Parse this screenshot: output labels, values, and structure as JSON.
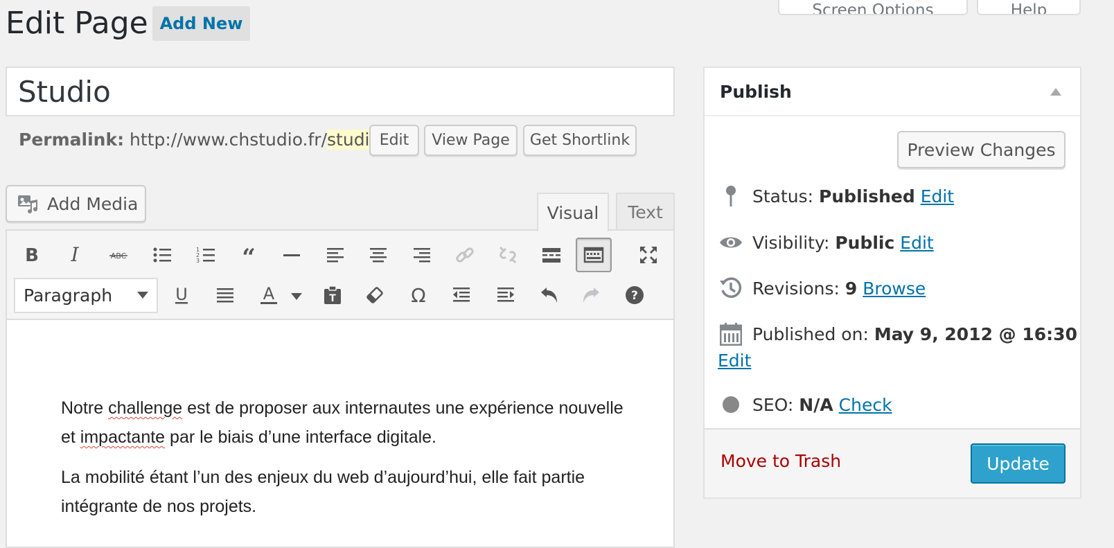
{
  "header": {
    "title": "Edit Page",
    "add_new": "Add New",
    "screen_options": "Screen Options",
    "help": "Help"
  },
  "post": {
    "title": "Studio",
    "permalink_label": "Permalink:",
    "permalink_base": "http://www.chstudio.fr/",
    "permalink_slug": "studio",
    "permalink_trail": "/",
    "edit_btn": "Edit",
    "view_page_btn": "View Page",
    "shortlink_btn": "Get Shortlink"
  },
  "editor": {
    "add_media": "Add Media",
    "tab_visual": "Visual",
    "tab_text": "Text",
    "format_select": "Paragraph",
    "p1_a": "Notre ",
    "p1_spell1": "challenge",
    "p1_b": " est de proposer aux internautes une expérience nouvelle et ",
    "p1_spell2": "impactante",
    "p1_c": " par le biais d’une interface digitale.",
    "p2": "La mobilité étant l’un des enjeux du web d’aujourd’hui, elle fait partie intégrante de nos projets."
  },
  "publish": {
    "title": "Publish",
    "preview_changes": "Preview Changes",
    "status_label": "Status:",
    "status_value": "Published",
    "status_edit": "Edit",
    "visibility_label": "Visibility:",
    "visibility_value": "Public",
    "visibility_edit": "Edit",
    "revisions_label": "Revisions:",
    "revisions_value": "9",
    "revisions_browse": "Browse",
    "published_label": "Published on:",
    "published_value": "May 9, 2012 @ 16:30",
    "published_edit": "Edit",
    "seo_label": "SEO:",
    "seo_value": "N/A",
    "seo_check": "Check",
    "move_to_trash": "Move to Trash",
    "update": "Update"
  },
  "colors": {
    "link": "#0073aa",
    "update_btn": "#2ea2cc",
    "trash": "#a00",
    "slug_highlight": "#fffbcc"
  }
}
